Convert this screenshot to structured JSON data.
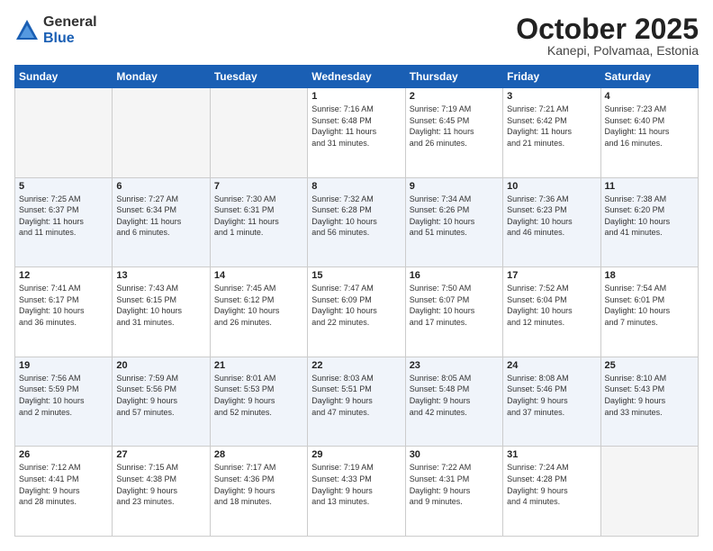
{
  "logo": {
    "general": "General",
    "blue": "Blue"
  },
  "header": {
    "month": "October 2025",
    "location": "Kanepi, Polvamaa, Estonia"
  },
  "weekdays": [
    "Sunday",
    "Monday",
    "Tuesday",
    "Wednesday",
    "Thursday",
    "Friday",
    "Saturday"
  ],
  "weeks": [
    [
      {
        "day": "",
        "info": ""
      },
      {
        "day": "",
        "info": ""
      },
      {
        "day": "",
        "info": ""
      },
      {
        "day": "1",
        "info": "Sunrise: 7:16 AM\nSunset: 6:48 PM\nDaylight: 11 hours\nand 31 minutes."
      },
      {
        "day": "2",
        "info": "Sunrise: 7:19 AM\nSunset: 6:45 PM\nDaylight: 11 hours\nand 26 minutes."
      },
      {
        "day": "3",
        "info": "Sunrise: 7:21 AM\nSunset: 6:42 PM\nDaylight: 11 hours\nand 21 minutes."
      },
      {
        "day": "4",
        "info": "Sunrise: 7:23 AM\nSunset: 6:40 PM\nDaylight: 11 hours\nand 16 minutes."
      }
    ],
    [
      {
        "day": "5",
        "info": "Sunrise: 7:25 AM\nSunset: 6:37 PM\nDaylight: 11 hours\nand 11 minutes."
      },
      {
        "day": "6",
        "info": "Sunrise: 7:27 AM\nSunset: 6:34 PM\nDaylight: 11 hours\nand 6 minutes."
      },
      {
        "day": "7",
        "info": "Sunrise: 7:30 AM\nSunset: 6:31 PM\nDaylight: 11 hours\nand 1 minute."
      },
      {
        "day": "8",
        "info": "Sunrise: 7:32 AM\nSunset: 6:28 PM\nDaylight: 10 hours\nand 56 minutes."
      },
      {
        "day": "9",
        "info": "Sunrise: 7:34 AM\nSunset: 6:26 PM\nDaylight: 10 hours\nand 51 minutes."
      },
      {
        "day": "10",
        "info": "Sunrise: 7:36 AM\nSunset: 6:23 PM\nDaylight: 10 hours\nand 46 minutes."
      },
      {
        "day": "11",
        "info": "Sunrise: 7:38 AM\nSunset: 6:20 PM\nDaylight: 10 hours\nand 41 minutes."
      }
    ],
    [
      {
        "day": "12",
        "info": "Sunrise: 7:41 AM\nSunset: 6:17 PM\nDaylight: 10 hours\nand 36 minutes."
      },
      {
        "day": "13",
        "info": "Sunrise: 7:43 AM\nSunset: 6:15 PM\nDaylight: 10 hours\nand 31 minutes."
      },
      {
        "day": "14",
        "info": "Sunrise: 7:45 AM\nSunset: 6:12 PM\nDaylight: 10 hours\nand 26 minutes."
      },
      {
        "day": "15",
        "info": "Sunrise: 7:47 AM\nSunset: 6:09 PM\nDaylight: 10 hours\nand 22 minutes."
      },
      {
        "day": "16",
        "info": "Sunrise: 7:50 AM\nSunset: 6:07 PM\nDaylight: 10 hours\nand 17 minutes."
      },
      {
        "day": "17",
        "info": "Sunrise: 7:52 AM\nSunset: 6:04 PM\nDaylight: 10 hours\nand 12 minutes."
      },
      {
        "day": "18",
        "info": "Sunrise: 7:54 AM\nSunset: 6:01 PM\nDaylight: 10 hours\nand 7 minutes."
      }
    ],
    [
      {
        "day": "19",
        "info": "Sunrise: 7:56 AM\nSunset: 5:59 PM\nDaylight: 10 hours\nand 2 minutes."
      },
      {
        "day": "20",
        "info": "Sunrise: 7:59 AM\nSunset: 5:56 PM\nDaylight: 9 hours\nand 57 minutes."
      },
      {
        "day": "21",
        "info": "Sunrise: 8:01 AM\nSunset: 5:53 PM\nDaylight: 9 hours\nand 52 minutes."
      },
      {
        "day": "22",
        "info": "Sunrise: 8:03 AM\nSunset: 5:51 PM\nDaylight: 9 hours\nand 47 minutes."
      },
      {
        "day": "23",
        "info": "Sunrise: 8:05 AM\nSunset: 5:48 PM\nDaylight: 9 hours\nand 42 minutes."
      },
      {
        "day": "24",
        "info": "Sunrise: 8:08 AM\nSunset: 5:46 PM\nDaylight: 9 hours\nand 37 minutes."
      },
      {
        "day": "25",
        "info": "Sunrise: 8:10 AM\nSunset: 5:43 PM\nDaylight: 9 hours\nand 33 minutes."
      }
    ],
    [
      {
        "day": "26",
        "info": "Sunrise: 7:12 AM\nSunset: 4:41 PM\nDaylight: 9 hours\nand 28 minutes."
      },
      {
        "day": "27",
        "info": "Sunrise: 7:15 AM\nSunset: 4:38 PM\nDaylight: 9 hours\nand 23 minutes."
      },
      {
        "day": "28",
        "info": "Sunrise: 7:17 AM\nSunset: 4:36 PM\nDaylight: 9 hours\nand 18 minutes."
      },
      {
        "day": "29",
        "info": "Sunrise: 7:19 AM\nSunset: 4:33 PM\nDaylight: 9 hours\nand 13 minutes."
      },
      {
        "day": "30",
        "info": "Sunrise: 7:22 AM\nSunset: 4:31 PM\nDaylight: 9 hours\nand 9 minutes."
      },
      {
        "day": "31",
        "info": "Sunrise: 7:24 AM\nSunset: 4:28 PM\nDaylight: 9 hours\nand 4 minutes."
      },
      {
        "day": "",
        "info": ""
      }
    ]
  ]
}
